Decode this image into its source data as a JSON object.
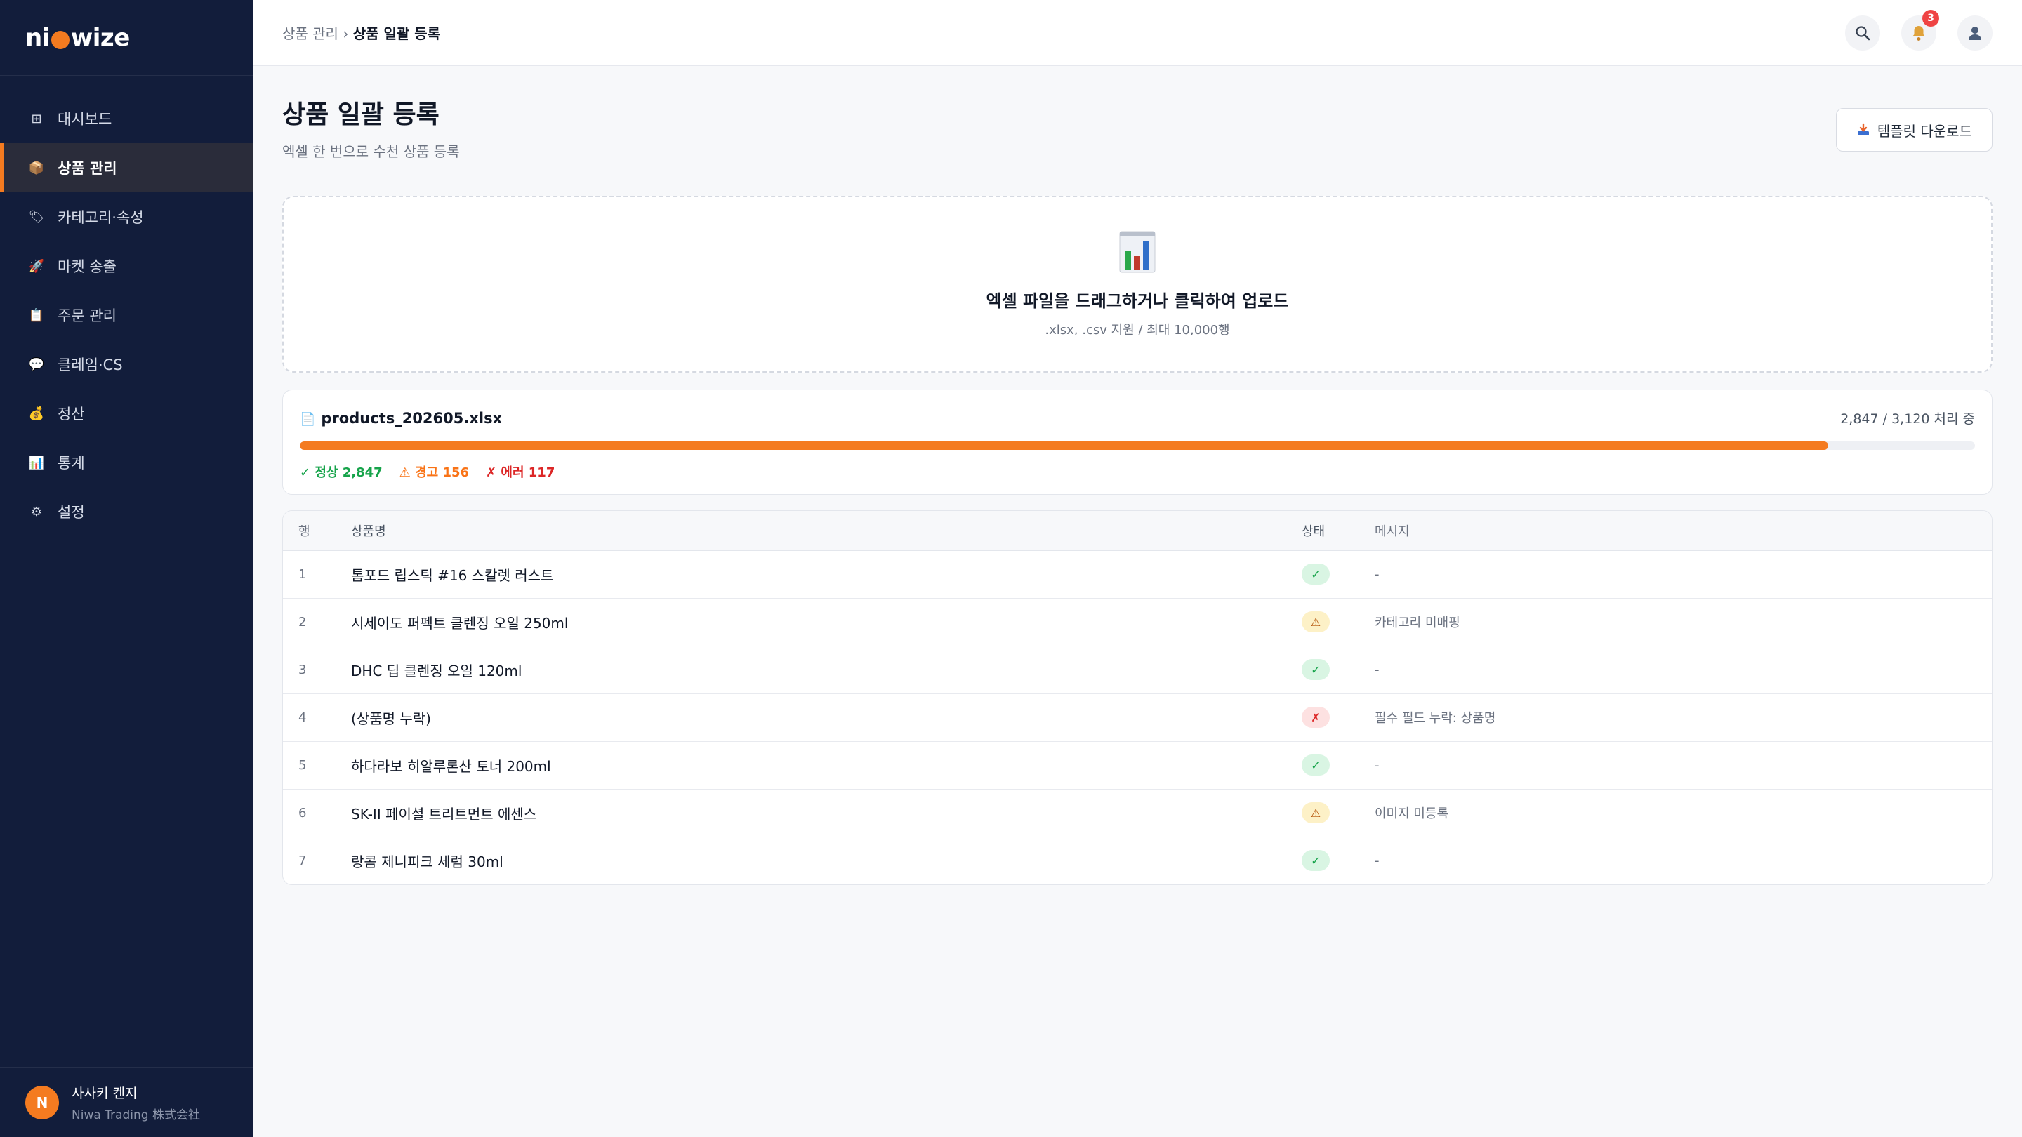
{
  "brand": {
    "logo_left": "ni",
    "logo_right": "wize"
  },
  "sidebar": {
    "items": [
      {
        "label": "대시보드",
        "icon": "grid-icon",
        "glyph": "⊞"
      },
      {
        "label": "상품 관리",
        "icon": "package-icon",
        "glyph": "📦",
        "active": true
      },
      {
        "label": "카테고리·속성",
        "icon": "tag-icon",
        "glyph": "🏷"
      },
      {
        "label": "마켓 송출",
        "icon": "rocket-icon",
        "glyph": "🚀"
      },
      {
        "label": "주문 관리",
        "icon": "clipboard-icon",
        "glyph": "📋"
      },
      {
        "label": "클레임·CS",
        "icon": "chat-icon",
        "glyph": "💬"
      },
      {
        "label": "정산",
        "icon": "money-bag-icon",
        "glyph": "💰"
      },
      {
        "label": "통계",
        "icon": "bar-chart-icon",
        "glyph": "📊"
      },
      {
        "label": "설정",
        "icon": "gear-icon",
        "glyph": "⚙"
      }
    ],
    "user": {
      "initial": "N",
      "name": "사사키 켄지",
      "org": "Niwa Trading 株式会社"
    }
  },
  "topbar": {
    "breadcrumb_parent": "상품 관리",
    "breadcrumb_sep": " › ",
    "breadcrumb_current": "상품 일괄 등록",
    "notification_count": "3"
  },
  "page": {
    "title": "상품 일괄 등록",
    "subtitle": "엑셀 한 번으로 수천 상품 등록",
    "template_button": "템플릿 다운로드"
  },
  "dropzone": {
    "main": "엑셀 파일을 드래그하거나 클릭하여 업로드",
    "sub": ".xlsx, .csv 지원 / 최대 10,000행"
  },
  "upload": {
    "file_name": "products_202605.xlsx",
    "progress_text": "2,847 / 3,120 처리 중",
    "progress": 0.9125,
    "ok": "✓ 정상 2,847",
    "warn": "⚠ 경고 156",
    "err": "✗ 에러 117"
  },
  "table": {
    "headers": {
      "row": "행",
      "name": "상품명",
      "status": "상태",
      "message": "메시지"
    },
    "rows": [
      {
        "row": "1",
        "name": "톰포드 립스틱 #16 스칼렛 러스트",
        "status": "ok",
        "message": "-"
      },
      {
        "row": "2",
        "name": "시세이도 퍼펙트 클렌징 오일 250ml",
        "status": "warn",
        "message": "카테고리 미매핑"
      },
      {
        "row": "3",
        "name": "DHC 딥 클렌징 오일 120ml",
        "status": "ok",
        "message": "-"
      },
      {
        "row": "4",
        "name": "(상품명 누락)",
        "status": "err",
        "message": "필수 필드 누락: 상품명"
      },
      {
        "row": "5",
        "name": "하다라보 히알루론산 토너 200ml",
        "status": "ok",
        "message": "-"
      },
      {
        "row": "6",
        "name": "SK-II 페이셜 트리트먼트 에센스",
        "status": "warn",
        "message": "이미지 미등록"
      },
      {
        "row": "7",
        "name": "랑콤 제니피크 세럼 30ml",
        "status": "ok",
        "message": "-"
      }
    ]
  },
  "status_glyphs": {
    "ok": "✓",
    "warn": "⚠",
    "err": "✗"
  }
}
